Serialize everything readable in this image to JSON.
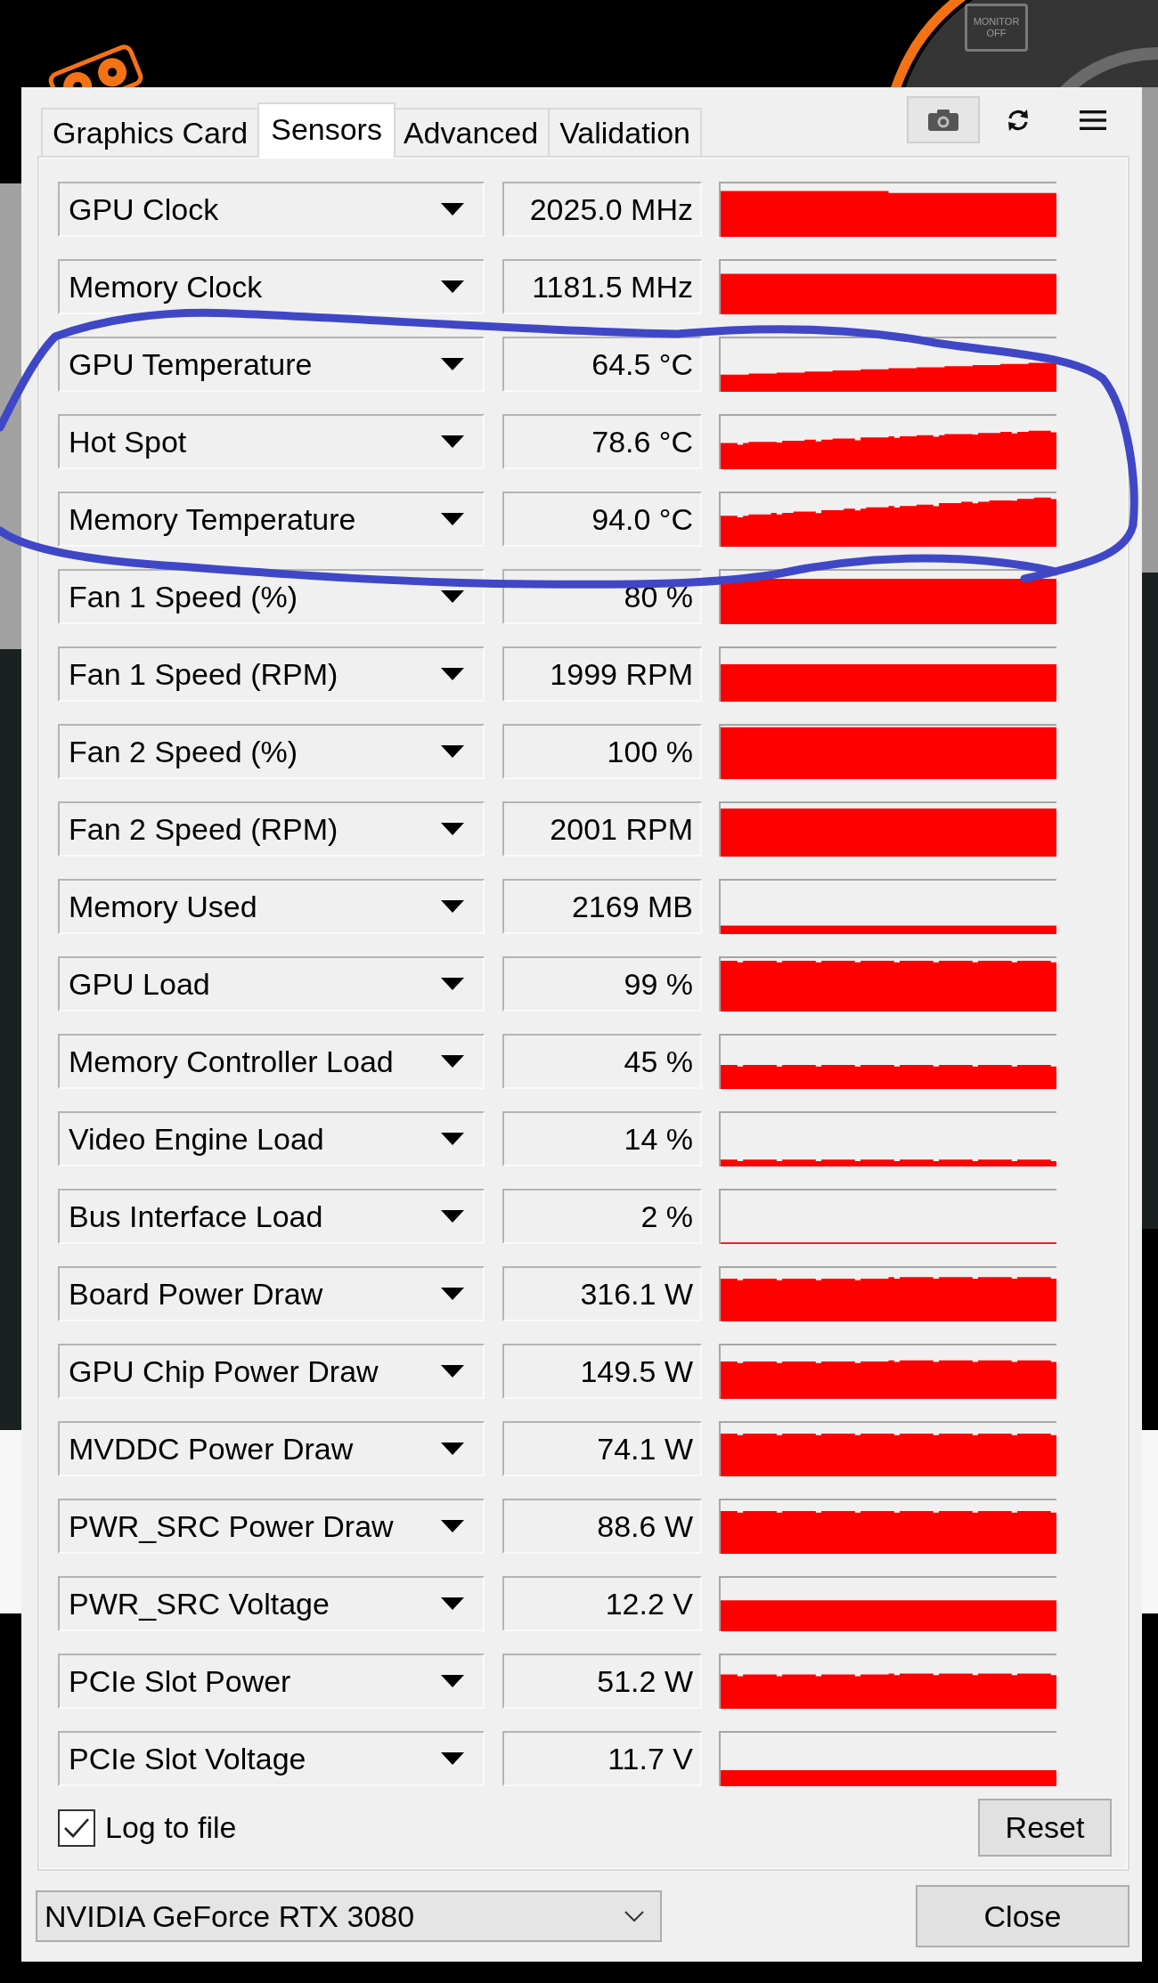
{
  "desktop": {
    "monitor_label": "MONITOR OFF"
  },
  "tabs": [
    {
      "label": "Graphics Card",
      "selected": false
    },
    {
      "label": "Sensors",
      "selected": true
    },
    {
      "label": "Advanced",
      "selected": false
    },
    {
      "label": "Validation",
      "selected": false
    }
  ],
  "sensors": [
    {
      "name": "GPU Clock",
      "value": "2025.0 MHz"
    },
    {
      "name": "Memory Clock",
      "value": "1181.5 MHz"
    },
    {
      "name": "GPU Temperature",
      "value": "64.5 °C"
    },
    {
      "name": "Hot Spot",
      "value": "78.6 °C"
    },
    {
      "name": "Memory Temperature",
      "value": "94.0 °C"
    },
    {
      "name": "Fan 1 Speed (%)",
      "value": "80 %"
    },
    {
      "name": "Fan 1 Speed (RPM)",
      "value": "1999 RPM"
    },
    {
      "name": "Fan 2 Speed (%)",
      "value": "100 %"
    },
    {
      "name": "Fan 2 Speed (RPM)",
      "value": "2001 RPM"
    },
    {
      "name": "Memory Used",
      "value": "2169 MB"
    },
    {
      "name": "GPU Load",
      "value": "99 %"
    },
    {
      "name": "Memory Controller Load",
      "value": "45 %"
    },
    {
      "name": "Video Engine Load",
      "value": "14 %"
    },
    {
      "name": "Bus Interface Load",
      "value": "2 %"
    },
    {
      "name": "Board Power Draw",
      "value": "316.1 W"
    },
    {
      "name": "GPU Chip Power Draw",
      "value": "149.5 W"
    },
    {
      "name": "MVDDC Power Draw",
      "value": "74.1 W"
    },
    {
      "name": "PWR_SRC Power Draw",
      "value": "88.6 W"
    },
    {
      "name": "PWR_SRC Voltage",
      "value": "12.2 V"
    },
    {
      "name": "PCIe Slot Power",
      "value": "51.2 W"
    },
    {
      "name": "PCIe Slot Voltage",
      "value": "11.7 V"
    }
  ],
  "log_to_file": {
    "label": "Log to file",
    "checked": true
  },
  "reset_button": "Reset",
  "gpu_select": {
    "value": "NVIDIA GeForce RTX 3080"
  },
  "close_button": "Close"
}
